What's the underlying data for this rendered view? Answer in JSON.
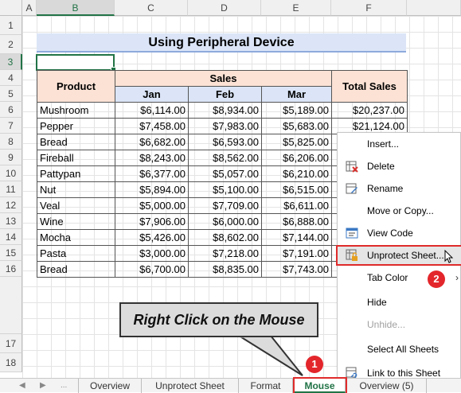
{
  "columns": [
    "A",
    "B",
    "C",
    "D",
    "E",
    "F"
  ],
  "rows": [
    "1",
    "2",
    "3",
    "4",
    "5",
    "6",
    "7",
    "8",
    "9",
    "10",
    "11",
    "12",
    "13",
    "14",
    "15",
    "16",
    "17",
    "18"
  ],
  "title": "Using Peripheral Device",
  "table": {
    "product_header": "Product",
    "sales_header": "Sales",
    "total_header": "Total Sales",
    "months": [
      "Jan",
      "Feb",
      "Mar"
    ],
    "rows": [
      {
        "product": "Mushroom",
        "jan": "$6,114.00",
        "feb": "$8,934.00",
        "mar": "$5,189.00",
        "total": "$20,237.00"
      },
      {
        "product": "Pepper",
        "jan": "$7,458.00",
        "feb": "$7,983.00",
        "mar": "$5,683.00",
        "total": "$21,124.00"
      },
      {
        "product": "Bread",
        "jan": "$6,682.00",
        "feb": "$6,593.00",
        "mar": "$5,825.00",
        "total": ""
      },
      {
        "product": "Fireball",
        "jan": "$8,243.00",
        "feb": "$8,562.00",
        "mar": "$6,206.00",
        "total": ""
      },
      {
        "product": "Pattypan",
        "jan": "$6,377.00",
        "feb": "$5,057.00",
        "mar": "$6,210.00",
        "total": ""
      },
      {
        "product": "Nut",
        "jan": "$5,894.00",
        "feb": "$5,100.00",
        "mar": "$6,515.00",
        "total": ""
      },
      {
        "product": "Veal",
        "jan": "$5,000.00",
        "feb": "$7,709.00",
        "mar": "$6,611.00",
        "total": ""
      },
      {
        "product": "Wine",
        "jan": "$7,906.00",
        "feb": "$6,000.00",
        "mar": "$6,888.00",
        "total": ""
      },
      {
        "product": "Mocha",
        "jan": "$5,426.00",
        "feb": "$8,602.00",
        "mar": "$7,144.00",
        "total": ""
      },
      {
        "product": "Pasta",
        "jan": "$3,000.00",
        "feb": "$7,218.00",
        "mar": "$7,191.00",
        "total": ""
      },
      {
        "product": "Bread",
        "jan": "$6,700.00",
        "feb": "$8,835.00",
        "mar": "$7,743.00",
        "total": ""
      }
    ]
  },
  "context_menu": {
    "items": [
      {
        "label": "Insert...",
        "icon": "none"
      },
      {
        "label": "Delete",
        "icon": "delete-sheet-icon"
      },
      {
        "label": "Rename",
        "icon": "rename-icon"
      },
      {
        "label": "Move or Copy...",
        "icon": "none"
      },
      {
        "label": "View Code",
        "icon": "view-code-icon"
      },
      {
        "label": "Unprotect Sheet...",
        "icon": "unprotect-sheet-icon"
      },
      {
        "label": "Tab Color",
        "icon": "none"
      },
      {
        "label": "Hide",
        "icon": "none"
      },
      {
        "label": "Unhide...",
        "icon": "none"
      },
      {
        "label": "Select All Sheets",
        "icon": "none"
      },
      {
        "label": "Link to this Sheet",
        "icon": "link-icon"
      }
    ],
    "submenu_arrow": "›"
  },
  "callout_text": "Right Click on the Mouse",
  "badges": [
    "1",
    "2"
  ],
  "tabs": [
    {
      "label": "Overview",
      "active": false
    },
    {
      "label": "Unprotect Sheet",
      "active": false
    },
    {
      "label": "Format",
      "active": false
    },
    {
      "label": "Mouse",
      "active": true
    },
    {
      "label": "Overview (5)",
      "active": false
    }
  ],
  "tab_nav": {
    "prev": "◀",
    "next": "▶",
    "more": "..."
  },
  "colors": {
    "accent": "#217346",
    "highlight": "#e02b2b",
    "title_bg": "#dbe5f7",
    "header_bg": "#fbe2d5"
  }
}
